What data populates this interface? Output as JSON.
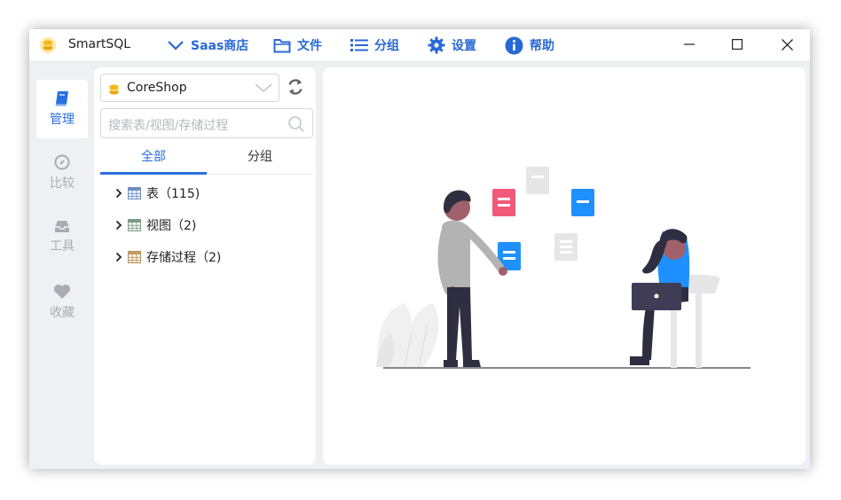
{
  "app": {
    "title": "SmartSQL"
  },
  "menu": {
    "saas_label": "Saas商店",
    "file_label": "文件",
    "group_label": "分组",
    "settings_label": "设置",
    "help_label": "帮助"
  },
  "window_controls": [
    "minimize",
    "maximize",
    "close"
  ],
  "nav": {
    "items": [
      {
        "label": "管理",
        "icon": "book-icon",
        "active": true
      },
      {
        "label": "比较",
        "icon": "compass-icon",
        "active": false
      },
      {
        "label": "工具",
        "icon": "inbox-icon",
        "active": false
      },
      {
        "label": "收藏",
        "icon": "heart-icon",
        "active": false
      }
    ]
  },
  "panel": {
    "db_name": "CoreShop",
    "search_placeholder": "搜索表/视图/存储过程",
    "tabs": [
      {
        "label": "全部",
        "active": true
      },
      {
        "label": "分组",
        "active": false
      }
    ],
    "tree": [
      {
        "label": "表（115)",
        "icon": "table-icon"
      },
      {
        "label": "视图（2)",
        "icon": "view-icon"
      },
      {
        "label": "存储过程（2)",
        "icon": "procedure-icon"
      }
    ]
  },
  "colors": {
    "accent": "#2a6fe0",
    "menu_blue": "#2868d6",
    "nav_inactive": "#a9adb3",
    "illustration_red": "#f2587a",
    "illustration_blue": "#1e90ff"
  }
}
